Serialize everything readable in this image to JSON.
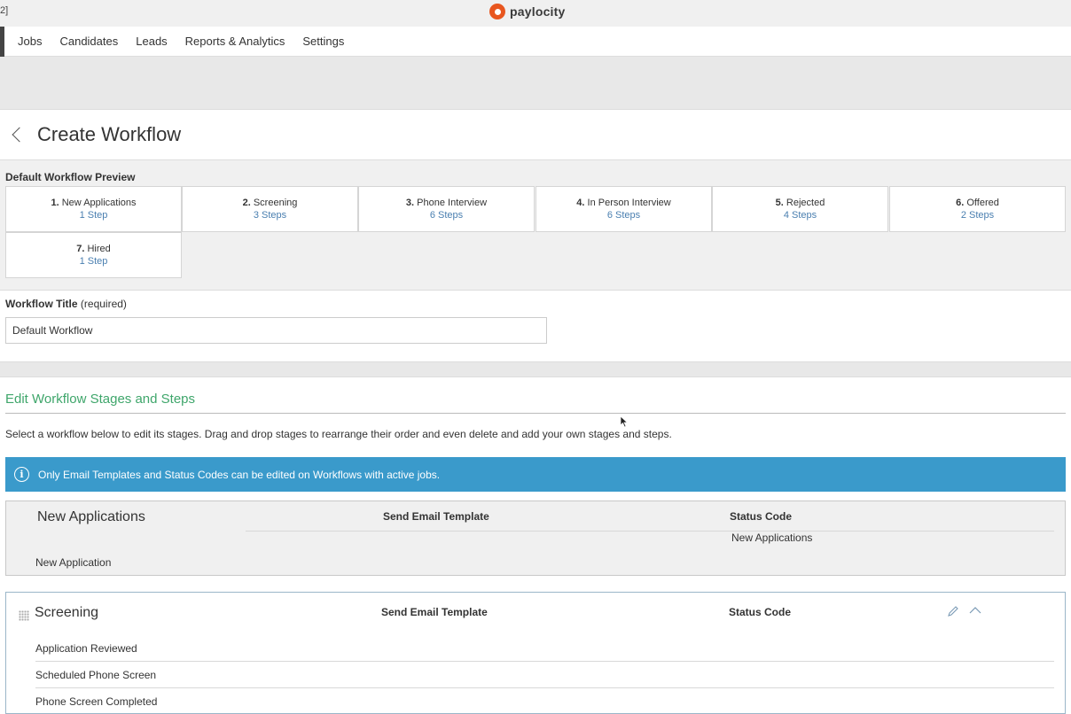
{
  "topbar": {
    "corner_text": "2]",
    "logo_text": "paylocity"
  },
  "nav": {
    "items": [
      "Jobs",
      "Candidates",
      "Leads",
      "Reports & Analytics",
      "Settings"
    ]
  },
  "page": {
    "title": "Create Workflow"
  },
  "preview": {
    "label": "Default Workflow Preview",
    "stages": [
      {
        "num": "1.",
        "name": "New Applications",
        "steps": "1 Step"
      },
      {
        "num": "2.",
        "name": "Screening",
        "steps": "3 Steps"
      },
      {
        "num": "3.",
        "name": "Phone Interview",
        "steps": "6 Steps"
      },
      {
        "num": "4.",
        "name": "In Person Interview",
        "steps": "6 Steps"
      },
      {
        "num": "5.",
        "name": "Rejected",
        "steps": "4 Steps"
      },
      {
        "num": "6.",
        "name": "Offered",
        "steps": "2 Steps"
      },
      {
        "num": "7.",
        "name": "Hired",
        "steps": "1 Step"
      }
    ]
  },
  "workflow_title": {
    "label": "Workflow Title",
    "required": "(required)",
    "value": "Default Workflow"
  },
  "edit": {
    "heading": "Edit Workflow Stages and Steps",
    "description": "Select a workflow below to edit its stages. Drag and drop stages to rearrange their order and even delete and add your own stages and steps.",
    "banner": "Only Email Templates and Status Codes can be edited on Workflows with active jobs."
  },
  "stage_new_applications": {
    "name": "New Applications",
    "email_header": "Send Email Template",
    "status_header": "Status Code",
    "status_value": "New Applications",
    "steps": [
      "New Application"
    ]
  },
  "stage_screening": {
    "name": "Screening",
    "email_header": "Send Email Template",
    "status_header": "Status Code",
    "steps": [
      "Application Reviewed",
      "Scheduled Phone Screen",
      "Phone Screen Completed"
    ]
  },
  "colors": {
    "accent_green": "#3fa66b",
    "banner_blue": "#3a9acb",
    "link_blue": "#4a7fb0",
    "logo_orange": "#e8561f"
  }
}
